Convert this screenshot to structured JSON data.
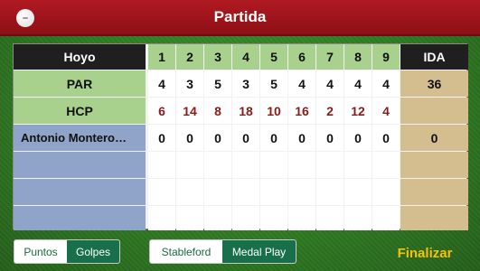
{
  "header": {
    "title": "Partida",
    "ball_icon": "golf-ball-icon"
  },
  "scorecard": {
    "hole_label": "Hoyo",
    "holes": [
      "1",
      "2",
      "3",
      "4",
      "5",
      "6",
      "7",
      "8",
      "9"
    ],
    "total_label": "IDA",
    "par": {
      "label": "PAR",
      "values": [
        "4",
        "3",
        "5",
        "3",
        "5",
        "4",
        "4",
        "4",
        "4"
      ],
      "total": "36"
    },
    "hcp": {
      "label": "HCP",
      "values": [
        "6",
        "14",
        "8",
        "18",
        "10",
        "16",
        "2",
        "12",
        "4"
      ]
    },
    "players": [
      {
        "name": "Antonio Montero…",
        "values": [
          "0",
          "0",
          "0",
          "0",
          "0",
          "0",
          "0",
          "0",
          "0"
        ],
        "total": "0"
      }
    ],
    "empty_rows": 3
  },
  "controls": {
    "score_mode": {
      "options": [
        "Puntos",
        "Golpes"
      ],
      "selected": "Golpes"
    },
    "game_mode": {
      "options": [
        "Stableford",
        "Medal Play"
      ],
      "selected": "Medal Play"
    },
    "finish_label": "Finalizar"
  },
  "colors": {
    "header_red": "#a3161d",
    "green_header": "#a9d18e",
    "player_blue": "#8fa4c8",
    "total_tan": "#d4bd8f",
    "hcp_red": "#8b1a1a",
    "accent_yellow": "#f4c200"
  }
}
